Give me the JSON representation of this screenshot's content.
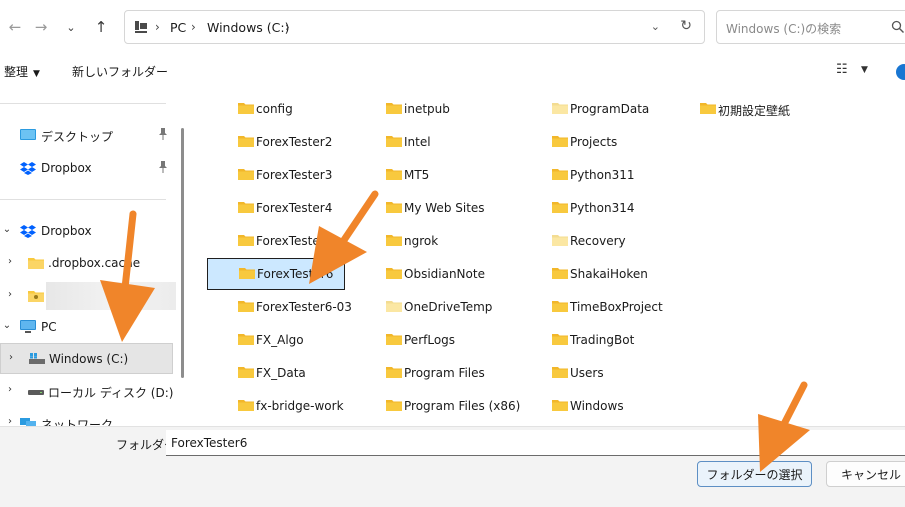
{
  "address_bar": {
    "crumbs": [
      "PC",
      "Windows (C:)"
    ],
    "search_placeholder": "Windows (C:)の検索"
  },
  "toolbar": {
    "organize_label": "整理",
    "new_folder_label": "新しいフォルダー"
  },
  "nav_pane": {
    "quick_access": [
      {
        "label": "デスクトップ",
        "icon": "desktop-icon",
        "pinned": true
      },
      {
        "label": "Dropbox",
        "icon": "dropbox-icon",
        "pinned": true
      }
    ],
    "tree": [
      {
        "label": "Dropbox",
        "icon": "dropbox-icon",
        "expanded": true
      },
      {
        "label": ".dropbox.cache",
        "icon": "folder-icon"
      },
      {
        "label": "",
        "icon": "folder-user-icon"
      },
      {
        "label": "PC",
        "icon": "pc-icon",
        "expanded": true
      },
      {
        "label": "Windows (C:)",
        "icon": "drive-c-icon",
        "selected": true
      },
      {
        "label": "ローカル ディスク (D:)",
        "icon": "drive-d-icon"
      },
      {
        "label": "ネットワーク",
        "icon": "network-icon"
      }
    ]
  },
  "files": [
    [
      "config",
      "ForexTester2",
      "ForexTester3",
      "ForexTester4",
      "ForexTester5",
      "ForexTester6",
      "ForexTester6-03",
      "FX_Algo",
      "FX_Data",
      "fx-bridge-work"
    ],
    [
      "inetpub",
      "Intel",
      "MT5",
      "My Web Sites",
      "ngrok",
      "ObsidianNote",
      "OneDriveTemp",
      "PerfLogs",
      "Program Files",
      "Program Files (x86)"
    ],
    [
      "ProgramData",
      "Projects",
      "Python311",
      "Python314",
      "Recovery",
      "ShakaiHoken",
      "TimeBoxProject",
      "TradingBot",
      "Users",
      "Windows"
    ],
    [
      "初期設定壁紙"
    ]
  ],
  "selected_file": "ForexTester6",
  "bottom": {
    "folder_label": "フォルダー:",
    "folder_value": "ForexTester6",
    "select_button": "フォルダーの選択",
    "cancel_button": "キャンセル"
  },
  "colors": {
    "folder_yellow": "#f8c93e",
    "folder_light": "#fbe7a3",
    "selection_bg": "#cce8ff",
    "annotation_arrow": "#f0852a",
    "accent_blue": "#1976d2"
  }
}
